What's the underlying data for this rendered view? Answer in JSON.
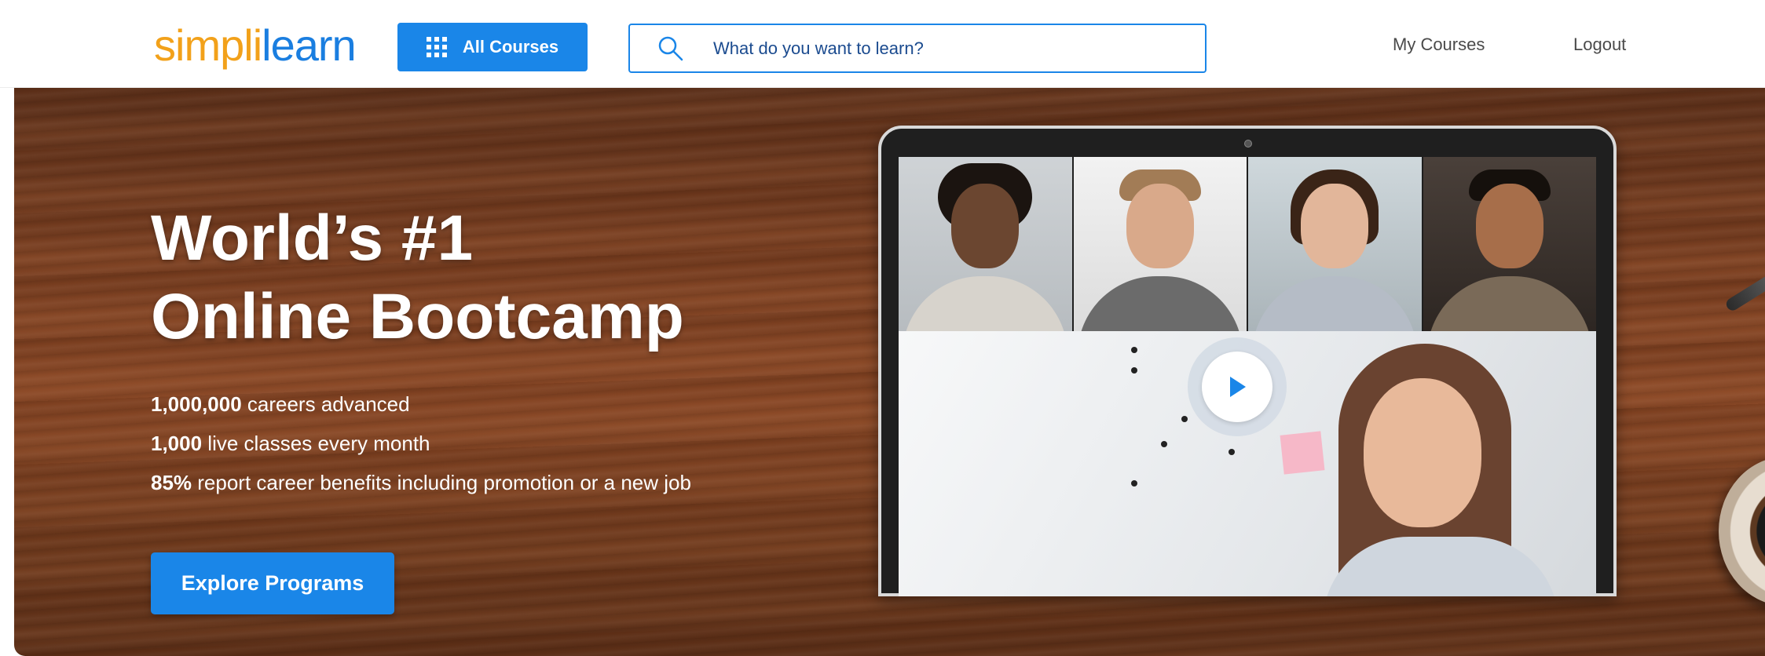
{
  "header": {
    "logo": {
      "part1": "simpl",
      "part2": "i",
      "part3": "learn"
    },
    "all_courses_label": "All Courses",
    "search_placeholder": "What do you want to learn?",
    "nav": {
      "my_courses": "My Courses",
      "logout": "Logout"
    },
    "icons": [
      "grid-icon",
      "search-icon"
    ]
  },
  "hero": {
    "title_line1": "World’s #1",
    "title_line2": "Online Bootcamp",
    "stats": [
      {
        "value": "1,000,000",
        "text": " careers advanced"
      },
      {
        "value": "1,000",
        "text": " live classes every month"
      },
      {
        "value": "85%",
        "text": " report career benefits including promotion or a new job"
      }
    ],
    "cta_label": "Explore Programs",
    "video": {
      "play_icon": "play-icon"
    }
  },
  "colors": {
    "brand_blue": "#1a86e8",
    "logo_orange": "#f2a11a",
    "logo_blue": "#1a7ee0",
    "hero_wood": "#7a3f21"
  }
}
